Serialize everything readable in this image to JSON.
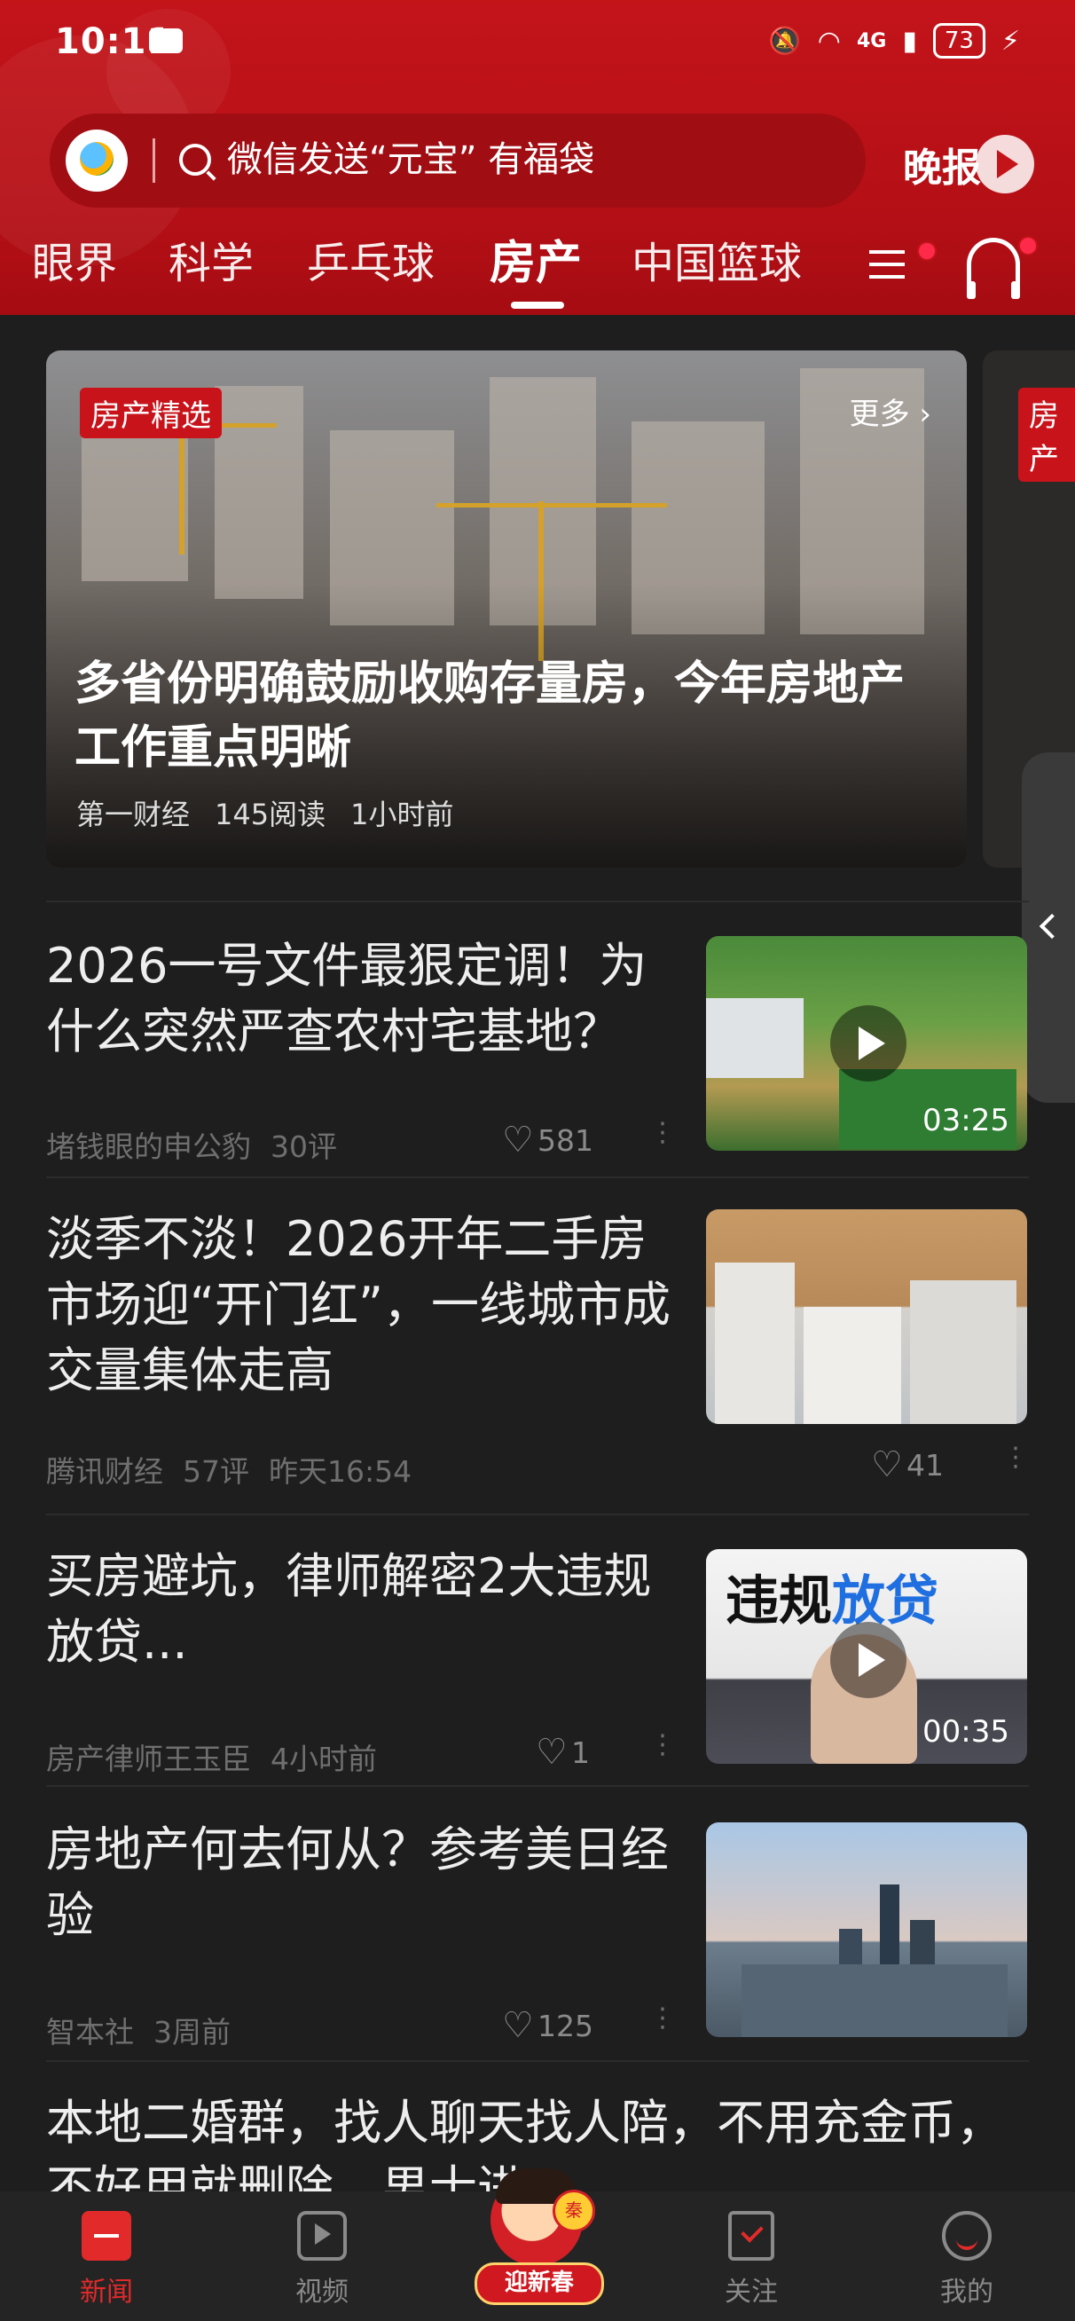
{
  "status_bar": {
    "time": "10:11",
    "network": "4G",
    "battery": "73"
  },
  "search": {
    "placeholder": "微信发送“元宝” 有福袋"
  },
  "evening_paper": {
    "label": "晚报"
  },
  "tabs": [
    {
      "label": "眼界",
      "active": false
    },
    {
      "label": "科学",
      "active": false
    },
    {
      "label": "乒乓球",
      "active": false
    },
    {
      "label": "房产",
      "active": true
    },
    {
      "label": "中国篮球",
      "active": false
    }
  ],
  "featured": {
    "badge": "房产精选",
    "more": "更多 ›",
    "title": "多省份明确鼓励收购存量房，今年房地产工作重点明晰",
    "source": "第一财经",
    "reads": "145阅读",
    "time": "1小时前",
    "next_badge": "房产"
  },
  "news": [
    {
      "title": "2026一号文件最狠定调！为什么突然严查农村宅基地？",
      "source": "堵钱眼的申公豹",
      "comments": "30评",
      "time": "",
      "likes": "581",
      "is_video": true,
      "duration": "03:25"
    },
    {
      "title": "淡季不淡！2026开年二手房市场迎“开门红”，一线城市成交量集体走高",
      "source": "腾讯财经",
      "comments": "57评",
      "time": "昨天16:54",
      "likes": "41",
      "is_video": false,
      "duration": ""
    },
    {
      "title": "买房避坑，律师解密2大违规放贷...",
      "source": "房产律师王玉臣",
      "comments": "",
      "time": "4小时前",
      "likes": "1",
      "is_video": true,
      "duration": "00:35",
      "thumb_text_a": "违规",
      "thumb_text_b": "放贷"
    },
    {
      "title": "房地产何去何从？参考美日经验",
      "source": "智本社",
      "comments": "",
      "time": "3周前",
      "likes": "125",
      "is_video": false,
      "duration": ""
    },
    {
      "title": "本地二婚群，找人聊天找人陪，不用充金币，不好用就删除，男士进"
    }
  ],
  "bottom_nav": [
    {
      "label": "新闻",
      "icon": "news-icon",
      "active": true
    },
    {
      "label": "视频",
      "icon": "video-icon",
      "active": false
    },
    {
      "label": "迎新春",
      "icon": "new-year-icon",
      "active": false
    },
    {
      "label": "关注",
      "icon": "follow-icon",
      "active": false
    },
    {
      "label": "我的",
      "icon": "me-icon",
      "active": false
    }
  ],
  "new_year_coin": "秦",
  "colors": {
    "brand_red": "#c3141a",
    "background": "#1e1e1e",
    "active_nav": "#e22a2a"
  }
}
